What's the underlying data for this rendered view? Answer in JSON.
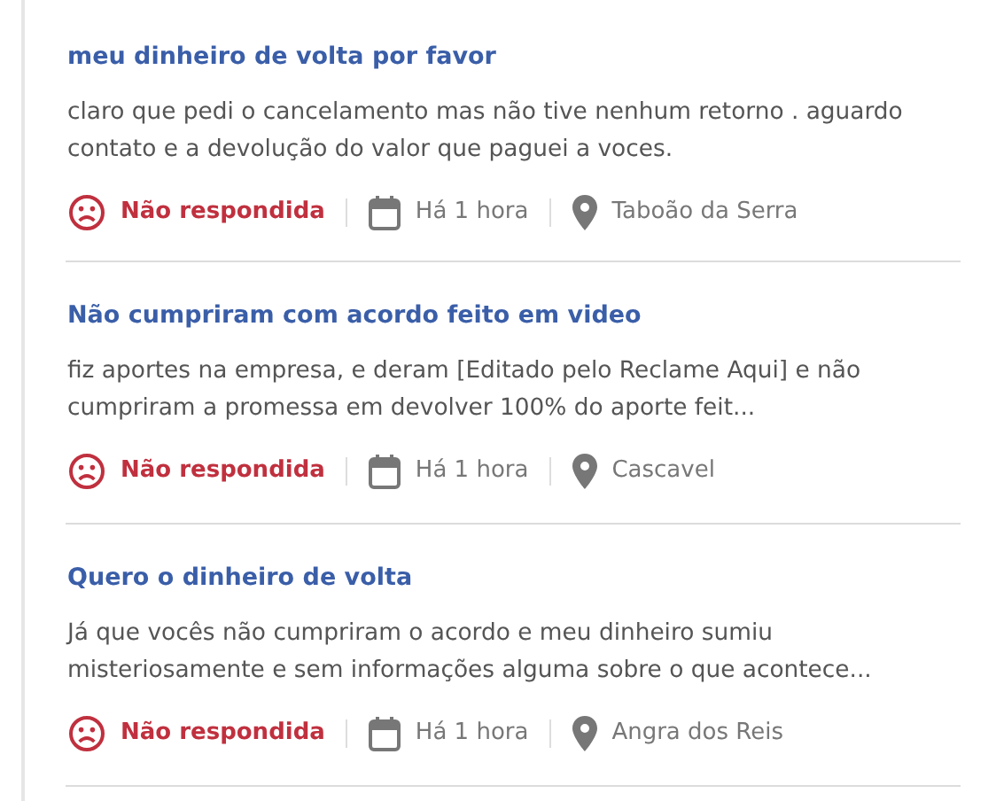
{
  "complaints": [
    {
      "title": "meu dinheiro de volta por favor",
      "body": "claro que pedi o cancelamento mas não tive nenhum retorno . aguardo contato e a devolução do valor que paguei a voces.",
      "status": {
        "kind": "unanswered",
        "label": "Não respondida"
      },
      "time": "Há 1 hora",
      "location": "Taboão da Serra"
    },
    {
      "title": "Não cumpriram com acordo feito em video",
      "body": "fiz aportes na empresa, e deram [Editado pelo Reclame Aqui] e não cumpriram a promessa em devolver 100% do aporte feit...",
      "status": {
        "kind": "unanswered",
        "label": "Não respondida"
      },
      "time": "Há 1 hora",
      "location": "Cascavel"
    },
    {
      "title": "Quero o dinheiro de volta",
      "body": "Já que vocês não cumpriram o acordo e meu dinheiro sumiu misteriosamente e sem informações alguma sobre o que acontece...",
      "status": {
        "kind": "unanswered",
        "label": "Não respondida"
      },
      "time": "Há 1 hora",
      "location": "Angra dos Reis"
    }
  ]
}
